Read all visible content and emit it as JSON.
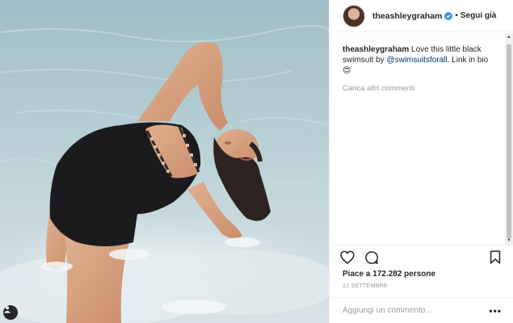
{
  "post": {
    "username": "theashleygraham",
    "follow_label": "Segui già",
    "dot_separator": "•",
    "caption": {
      "username": "theashleygraham",
      "text_before": " Love this little black swimsuit by ",
      "mention": "@swimsuitsforall",
      "text_after": ". Link in bio😍"
    },
    "load_more_label": "Carica altri commenti",
    "likes_label": "Piace a 172.282 persone",
    "date_label": "12 SETTEMBRE",
    "comment_placeholder": "Aggiungi un commento...",
    "more_label": "•••"
  },
  "icons": {
    "heart": "heart-icon",
    "comment": "comment-icon",
    "bookmark": "bookmark-icon",
    "verified": "verified-badge-icon",
    "tagged_user": "user-tag-icon"
  },
  "colors": {
    "verified_blue": "#3897f0",
    "mention_blue": "#003569",
    "muted_gray": "#999999",
    "water": "#b3ccd3",
    "swimsuit": "#1b1b1d"
  }
}
